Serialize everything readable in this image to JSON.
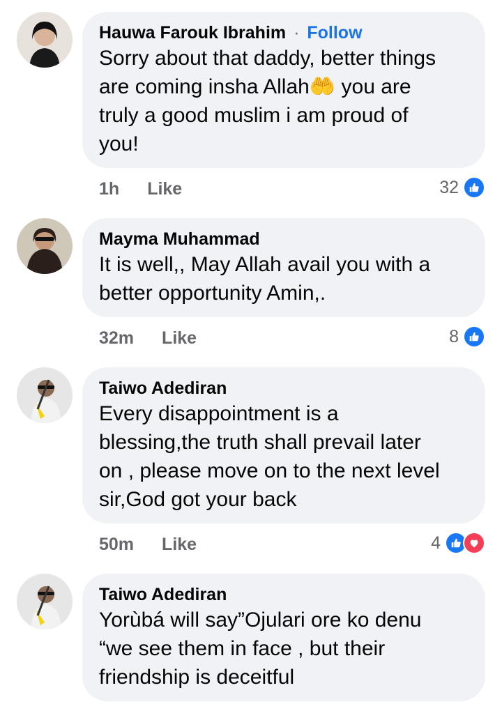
{
  "comments": [
    {
      "author": "Hauwa Farouk Ibrahim",
      "follow_separator": "·",
      "follow_label": "Follow",
      "text": "Sorry about that daddy, better things\nare coming insha Allah🤲 you are\ntruly a good muslim i am proud of\nyou!",
      "time": "1h",
      "like_label": "Like",
      "reaction_count": "32",
      "reactions": [
        "like"
      ]
    },
    {
      "author": "Mayma Muhammad",
      "text": "It is well,, May Allah avail you  with a\nbetter opportunity Amin,.",
      "time": "32m",
      "like_label": "Like",
      "reaction_count": "8",
      "reactions": [
        "like"
      ]
    },
    {
      "author": "Taiwo Adediran",
      "text": "Every disappointment is a\nblessing,the truth shall prevail later\non , please move on to the next level\nsir,God got your back",
      "time": "50m",
      "like_label": "Like",
      "reaction_count": "4",
      "reactions": [
        "like",
        "love"
      ]
    },
    {
      "author": "Taiwo Adediran",
      "text": "Yorùbá will say”Ojulari ore ko denu\n“we see them in face , but their\nfriendship is deceitful"
    }
  ],
  "colors": {
    "bubble": "#f0f2f5",
    "follow": "#1b74e4",
    "like_reaction": "#1877f2",
    "love_reaction": "#f33e58",
    "meta_text": "#65676b"
  }
}
